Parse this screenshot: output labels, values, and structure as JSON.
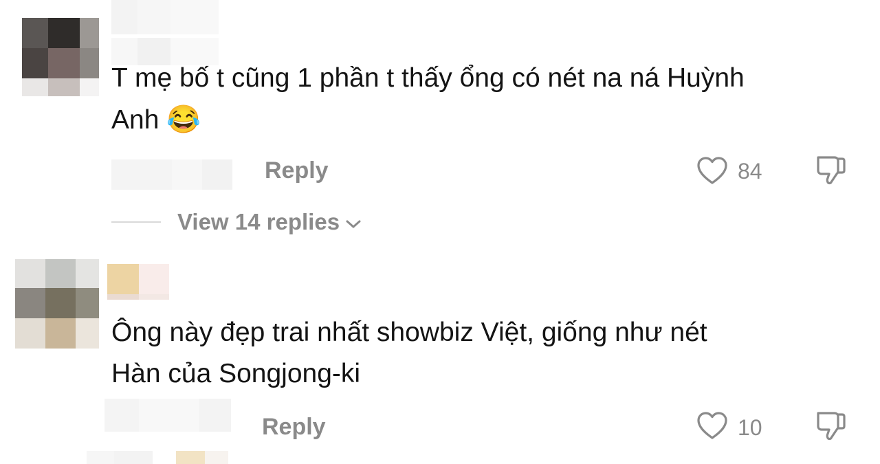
{
  "comments": [
    {
      "text_line1": "T mẹ bố t cũng 1 phần t thấy ổng có nét na ná Huỳnh",
      "text_line2": "Anh",
      "emoji": "😂",
      "reply_label": "Reply",
      "like_count": "84",
      "view_replies_label": "View 14 replies"
    },
    {
      "text_line1": "Ông này đẹp trai nhất showbiz Việt, giống như nét",
      "text_line2": "Hàn của Songjong-ki",
      "reply_label": "Reply",
      "like_count": "10"
    }
  ],
  "icons": {
    "like": "heart-outline-icon",
    "dislike": "thumbs-down-icon",
    "expand": "chevron-down-icon"
  },
  "colors": {
    "text": "#141414",
    "muted": "#8a8a8a",
    "divider": "#d9d9d9"
  }
}
